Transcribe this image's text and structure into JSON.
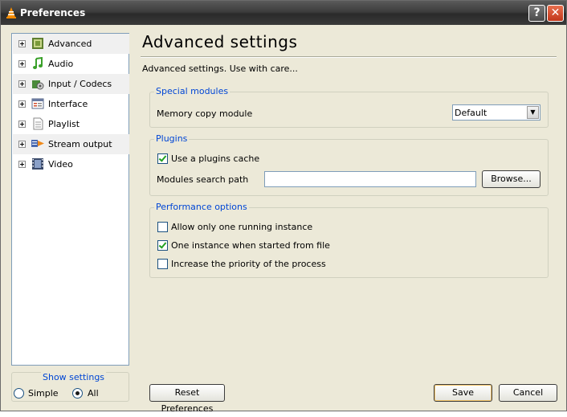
{
  "window": {
    "title": "Preferences",
    "help_label": "?",
    "close_label": "✕"
  },
  "tree": {
    "items": [
      {
        "label": "Advanced",
        "icon": "chip-icon"
      },
      {
        "label": "Audio",
        "icon": "music-note-icon"
      },
      {
        "label": "Input / Codecs",
        "icon": "input-codecs-icon"
      },
      {
        "label": "Interface",
        "icon": "interface-icon"
      },
      {
        "label": "Playlist",
        "icon": "playlist-icon"
      },
      {
        "label": "Stream output",
        "icon": "stream-output-icon"
      },
      {
        "label": "Video",
        "icon": "film-icon"
      }
    ]
  },
  "show_settings": {
    "title": "Show settings",
    "options": [
      "Simple",
      "All"
    ],
    "selected": "All"
  },
  "panel": {
    "title": "Advanced settings",
    "subtitle": "Advanced settings. Use with care...",
    "special_modules": {
      "title": "Special modules",
      "memory_copy_label": "Memory copy module",
      "memory_copy_value": "Default"
    },
    "plugins": {
      "title": "Plugins",
      "use_cache_label": "Use a plugins cache",
      "use_cache_checked": true,
      "search_path_label": "Modules search path",
      "search_path_value": "",
      "browse_label": "Browse..."
    },
    "performance": {
      "title": "Performance options",
      "options": [
        {
          "label": "Allow only one running instance",
          "checked": false
        },
        {
          "label": "One instance when started from file",
          "checked": true
        },
        {
          "label": "Increase the priority of the process",
          "checked": false
        }
      ]
    }
  },
  "footer": {
    "reset_label": "Reset Preferences",
    "save_label": "Save",
    "cancel_label": "Cancel"
  }
}
